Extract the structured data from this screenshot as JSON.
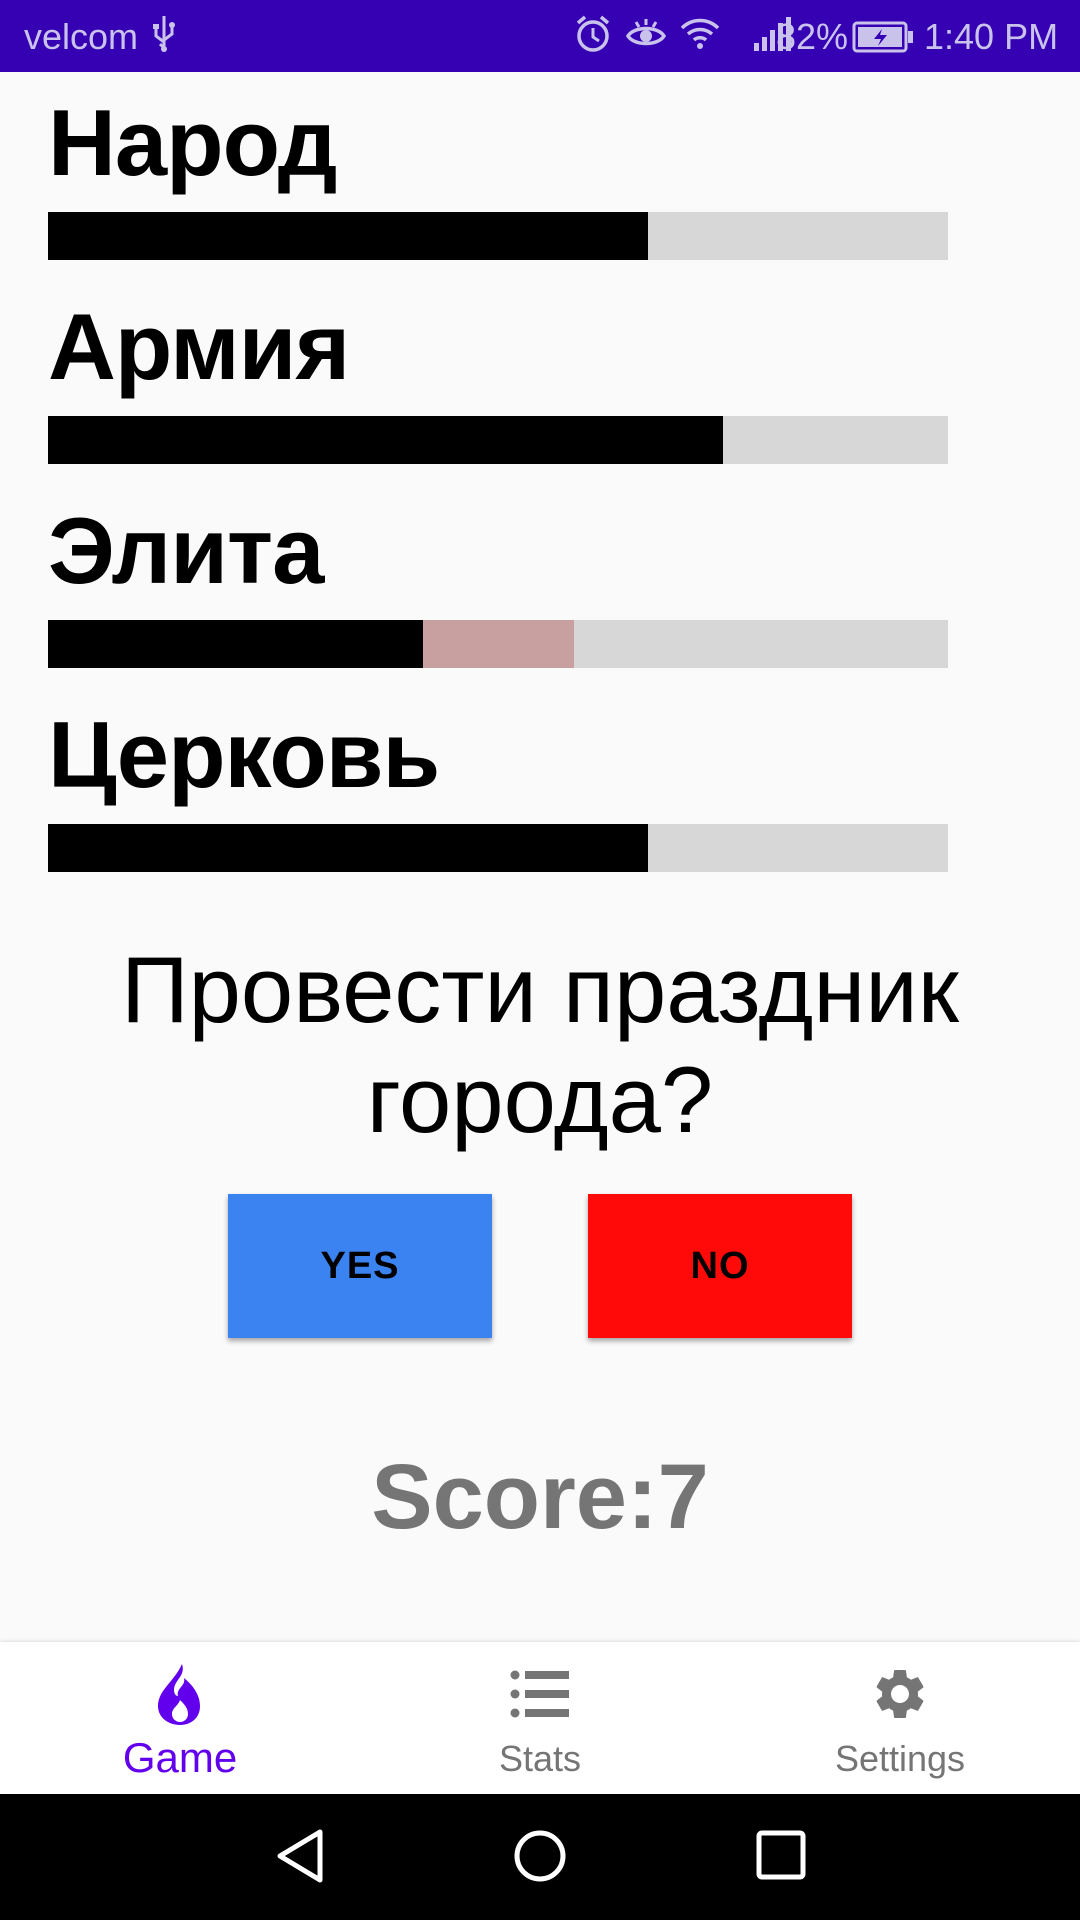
{
  "status_bar": {
    "carrier": "velcom",
    "battery_percent": "82%",
    "time": "1:40 PM"
  },
  "stats": [
    {
      "label": "Народ",
      "value": 0.667
    },
    {
      "label": "Армия",
      "value": 0.75
    },
    {
      "label": "Элита",
      "value": 0.417,
      "change": 0.167
    },
    {
      "label": "Церковь",
      "value": 0.667
    }
  ],
  "question": "Провести праздник города?",
  "buttons": {
    "yes_label": "YES",
    "no_label": "NO"
  },
  "score_text": "Score:7",
  "bottom_nav": {
    "items": [
      {
        "label": "Game",
        "icon": "flame-icon",
        "active": true
      },
      {
        "label": "Stats",
        "icon": "list-icon",
        "active": false
      },
      {
        "label": "Settings",
        "icon": "gear-icon",
        "active": false
      }
    ]
  },
  "colors": {
    "status_bar": "#3600b3",
    "accent": "#6200ee",
    "yes_button": "#3a83f1",
    "no_button": "#ff0909",
    "bar_track": "#d7d7d7",
    "bar_fill": "#000000",
    "bar_change": "#c8a0a0"
  }
}
